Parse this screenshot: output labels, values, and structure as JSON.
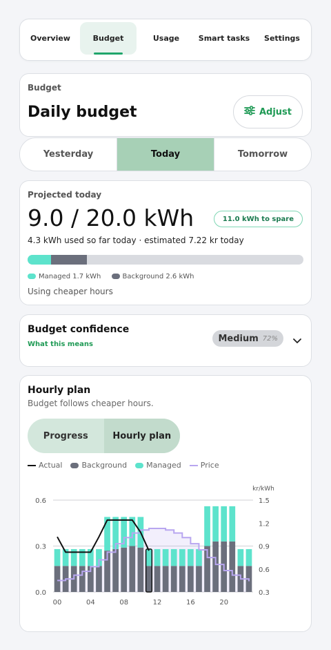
{
  "nav": {
    "tabs": [
      "Overview",
      "Budget",
      "Usage",
      "Smart tasks",
      "Settings"
    ],
    "active_index": 1
  },
  "budget": {
    "section_label": "Budget",
    "title": "Daily budget",
    "adjust_label": "Adjust"
  },
  "days": {
    "items": [
      "Yesterday",
      "Today",
      "Tomorrow"
    ],
    "active_index": 1
  },
  "projected": {
    "label": "Projected today",
    "value": "9.0 / 20.0 kWh",
    "spare_badge": "11.0 kWh to spare",
    "subtitle": "4.3 kWh used so far today · estimated 7.22 kr today",
    "managed_kwh": 1.7,
    "background_kwh": 2.6,
    "budget_kwh": 20.0,
    "legend_managed": "Managed 1.7 kWh",
    "legend_background": "Background 2.6 kWh",
    "note": "Using cheaper hours",
    "colors": {
      "managed": "#5de3cc",
      "background": "#6b6f7c",
      "track": "#d9dbe0"
    }
  },
  "confidence": {
    "title": "Budget confidence",
    "link": "What this means",
    "level": "Medium",
    "percent": "72%"
  },
  "hourly": {
    "title": "Hourly plan",
    "subtitle": "Budget follows cheaper hours.",
    "toggle": [
      "Progress",
      "Hourly plan"
    ],
    "toggle_active_index": 1,
    "legend": [
      "Actual",
      "Background",
      "Managed",
      "Price"
    ]
  },
  "chart_data": {
    "type": "bar",
    "x": [
      0,
      1,
      2,
      3,
      4,
      5,
      6,
      7,
      8,
      9,
      10,
      11,
      12,
      13,
      14,
      15,
      16,
      17,
      18,
      19,
      20,
      21,
      22,
      23
    ],
    "x_tick_labels": [
      "00",
      "04",
      "08",
      "12",
      "16",
      "20"
    ],
    "series": [
      {
        "name": "Background",
        "values": [
          0.17,
          0.17,
          0.17,
          0.17,
          0.17,
          0.17,
          0.27,
          0.28,
          0.29,
          0.3,
          0.29,
          0.17,
          0.17,
          0.17,
          0.17,
          0.17,
          0.17,
          0.17,
          0.3,
          0.33,
          0.33,
          0.33,
          0.17,
          0.17
        ]
      },
      {
        "name": "Managed",
        "values": [
          0.11,
          0.11,
          0.11,
          0.11,
          0.11,
          0.11,
          0.22,
          0.21,
          0.2,
          0.19,
          0.2,
          0.11,
          0.11,
          0.11,
          0.11,
          0.11,
          0.11,
          0.11,
          0.26,
          0.23,
          0.23,
          0.23,
          0.11,
          0.11
        ]
      },
      {
        "name": "Actual",
        "values": [
          0.36,
          0.26,
          0.26,
          0.26,
          0.26,
          0.36,
          0.47,
          0.47,
          0.47,
          0.47,
          0.39,
          0.27
        ]
      },
      {
        "name": "Price",
        "values": [
          0.45,
          0.47,
          0.52,
          0.57,
          0.63,
          0.72,
          0.82,
          0.93,
          1.01,
          1.07,
          1.11,
          1.13,
          1.13,
          1.11,
          1.07,
          1.01,
          0.93,
          0.85,
          0.75,
          0.66,
          0.58,
          0.52,
          0.47,
          0.44
        ]
      }
    ],
    "highlight_hour": 11,
    "ylim": [
      0,
      0.6
    ],
    "y_ticks": [
      "0.0",
      "0.3",
      "0.6"
    ],
    "y2_label": "kr/kWh",
    "y2lim": [
      0.3,
      1.5
    ],
    "y2_ticks": [
      "0.3",
      "0.6",
      "0.9",
      "1.2",
      "1.5"
    ],
    "colors": {
      "background": "#6b6f7c",
      "managed": "#5de3cc",
      "actual": "#111111",
      "price": "#b8a6f0"
    }
  }
}
